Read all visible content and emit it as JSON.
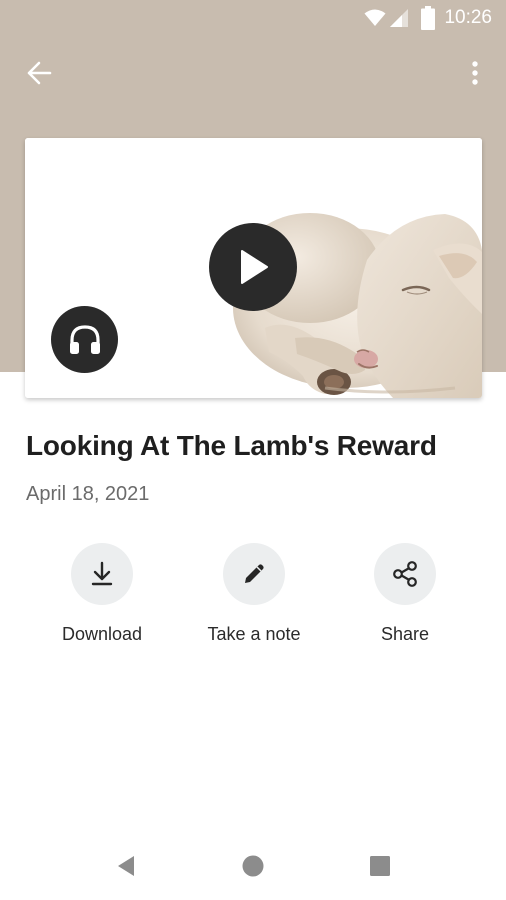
{
  "status_bar": {
    "time": "10:26",
    "icons": [
      "wifi-icon",
      "signal-icon",
      "battery-icon"
    ]
  },
  "toolbar": {
    "back_icon": "arrow-left-icon",
    "menu_icon": "more-vertical-icon"
  },
  "media": {
    "thumbnail": "sleeping-lamb-image",
    "play_icon": "play-icon",
    "audio_icon": "headphones-icon"
  },
  "sermon": {
    "title": "Looking At The Lamb's Reward",
    "date": "April 18, 2021"
  },
  "actions": [
    {
      "label": "Download",
      "icon": "download-icon"
    },
    {
      "label": "Take a note",
      "icon": "pencil-icon"
    },
    {
      "label": "Share",
      "icon": "share-icon"
    }
  ],
  "nav": {
    "icons": [
      "back-triangle-icon",
      "home-circle-icon",
      "recents-square-icon"
    ]
  },
  "colors": {
    "header_background": "#c8bcaf",
    "button_dark": "#2a2a2a",
    "action_circle": "#eceeef",
    "title_text": "#1f1f1f",
    "date_text": "#6b6b6b"
  }
}
